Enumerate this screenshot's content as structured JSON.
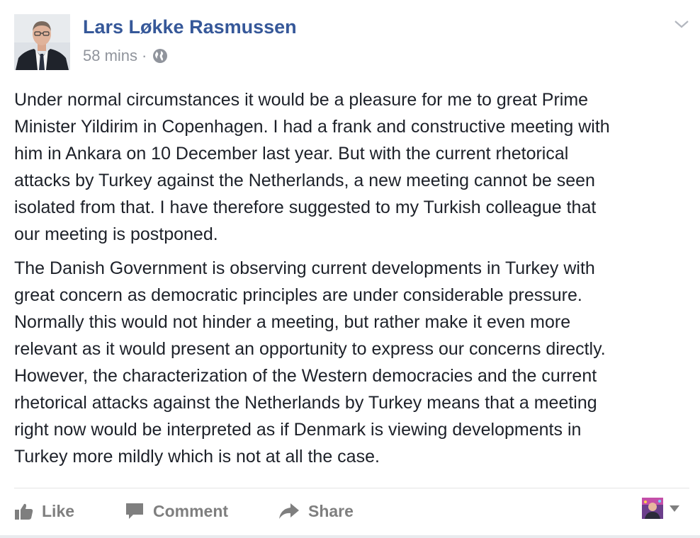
{
  "post": {
    "author": "Lars Løkke Rasmussen",
    "time": "58 mins",
    "separator": "·",
    "privacy_icon": "globe-icon",
    "options_icon": "chevron-down-icon",
    "paragraphs": [
      "Under normal circumstances it would be a pleasure for me to great Prime\nMinister Yildirim in Copenhagen. I had a frank and constructive meeting with\nhim in Ankara on 10 December last year. But with the current rhetorical\nattacks by Turkey against the Netherlands, a new meeting cannot be seen\nisolated from that. I have therefore suggested to my Turkish colleague that\nour meeting is postponed.",
      "The Danish Government is observing current developments in Turkey with\ngreat concern as democratic principles are under considerable pressure.\nNormally this would not hinder a meeting, but rather make it even more\nrelevant as it would present an opportunity to express our concerns directly.\nHowever, the characterization of the Western democracies and the current\nrhetorical attacks against the Netherlands by Turkey means that a meeting\nright now would be interpreted as if Denmark is viewing developments in\nTurkey more mildly which is not at all the case."
    ]
  },
  "actions": {
    "like": "Like",
    "comment": "Comment",
    "share": "Share",
    "like_icon": "thumbs-up-icon",
    "comment_icon": "speech-bubble-icon",
    "share_icon": "share-arrow-icon",
    "reactor_caret_icon": "caret-down-icon"
  },
  "colors": {
    "author": "#365899",
    "meta": "#90949c",
    "body_text": "#1d2129",
    "action_text": "#7f7f7f",
    "divider": "#e5e5e5"
  }
}
